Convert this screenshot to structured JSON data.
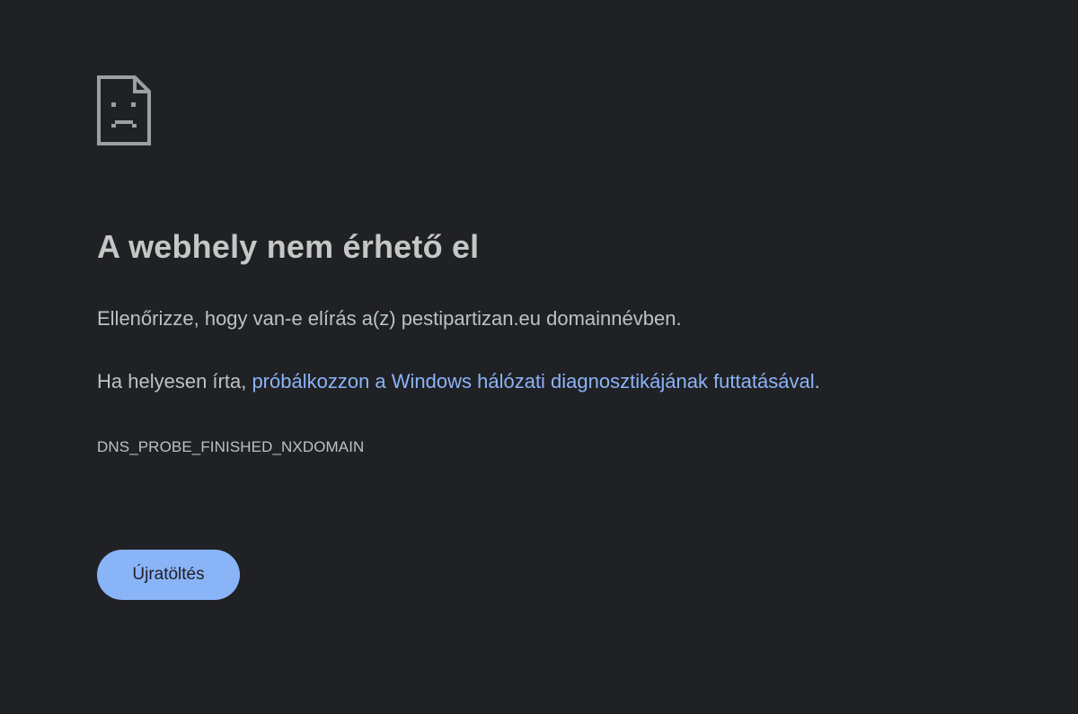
{
  "error": {
    "icon": "sad-page-icon",
    "title": "A webhely nem érhető el",
    "check_text": "Ellenőrizze, hogy van-e elírás a(z) pestipartizan.eu domainnévben.",
    "suggestion_prefix": "Ha helyesen írta, ",
    "diagnostics_link": "próbálkozzon a Windows hálózati diagnosztikájának futtatásával",
    "suggestion_suffix": ".",
    "code": "DNS_PROBE_FINISHED_NXDOMAIN",
    "reload_label": "Újratöltés"
  },
  "colors": {
    "background": "#202124",
    "title": "#c4c7c5",
    "text": "#bdc1c6",
    "link": "#8ab4f8",
    "button": "#8ab4f8"
  }
}
